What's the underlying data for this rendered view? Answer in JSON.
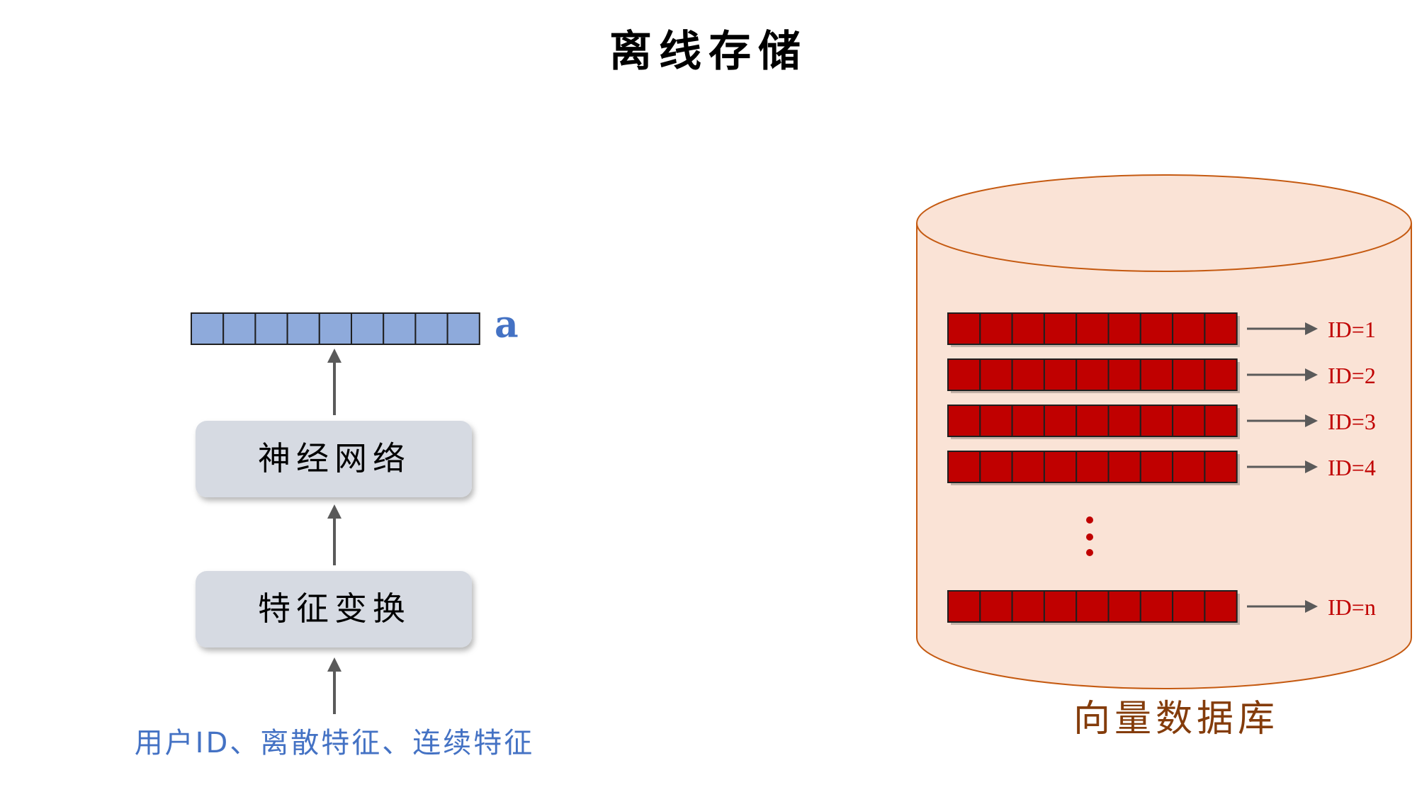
{
  "title": "离线存储",
  "left": {
    "vector_label": "a",
    "vector_cells": 9,
    "box_top": "神经网络",
    "box_bottom": "特征变换",
    "input_text": "用户ID、离散特征、连续特征"
  },
  "database": {
    "label": "向量数据库",
    "rows": [
      {
        "id_label": "ID=1"
      },
      {
        "id_label": "ID=2"
      },
      {
        "id_label": "ID=3"
      },
      {
        "id_label": "ID=4"
      },
      {
        "id_label": "ID=n"
      }
    ],
    "vector_cells": 9
  },
  "colors": {
    "blue_cell": "#8eaadb",
    "blue_text": "#4472c4",
    "red_cell": "#c00000",
    "red_text": "#c00000",
    "db_fill": "#fae3d6",
    "db_stroke": "#c55a11",
    "db_label": "#843c0b",
    "box_fill": "#d6dae2",
    "arrow": "#5a5a5a"
  }
}
